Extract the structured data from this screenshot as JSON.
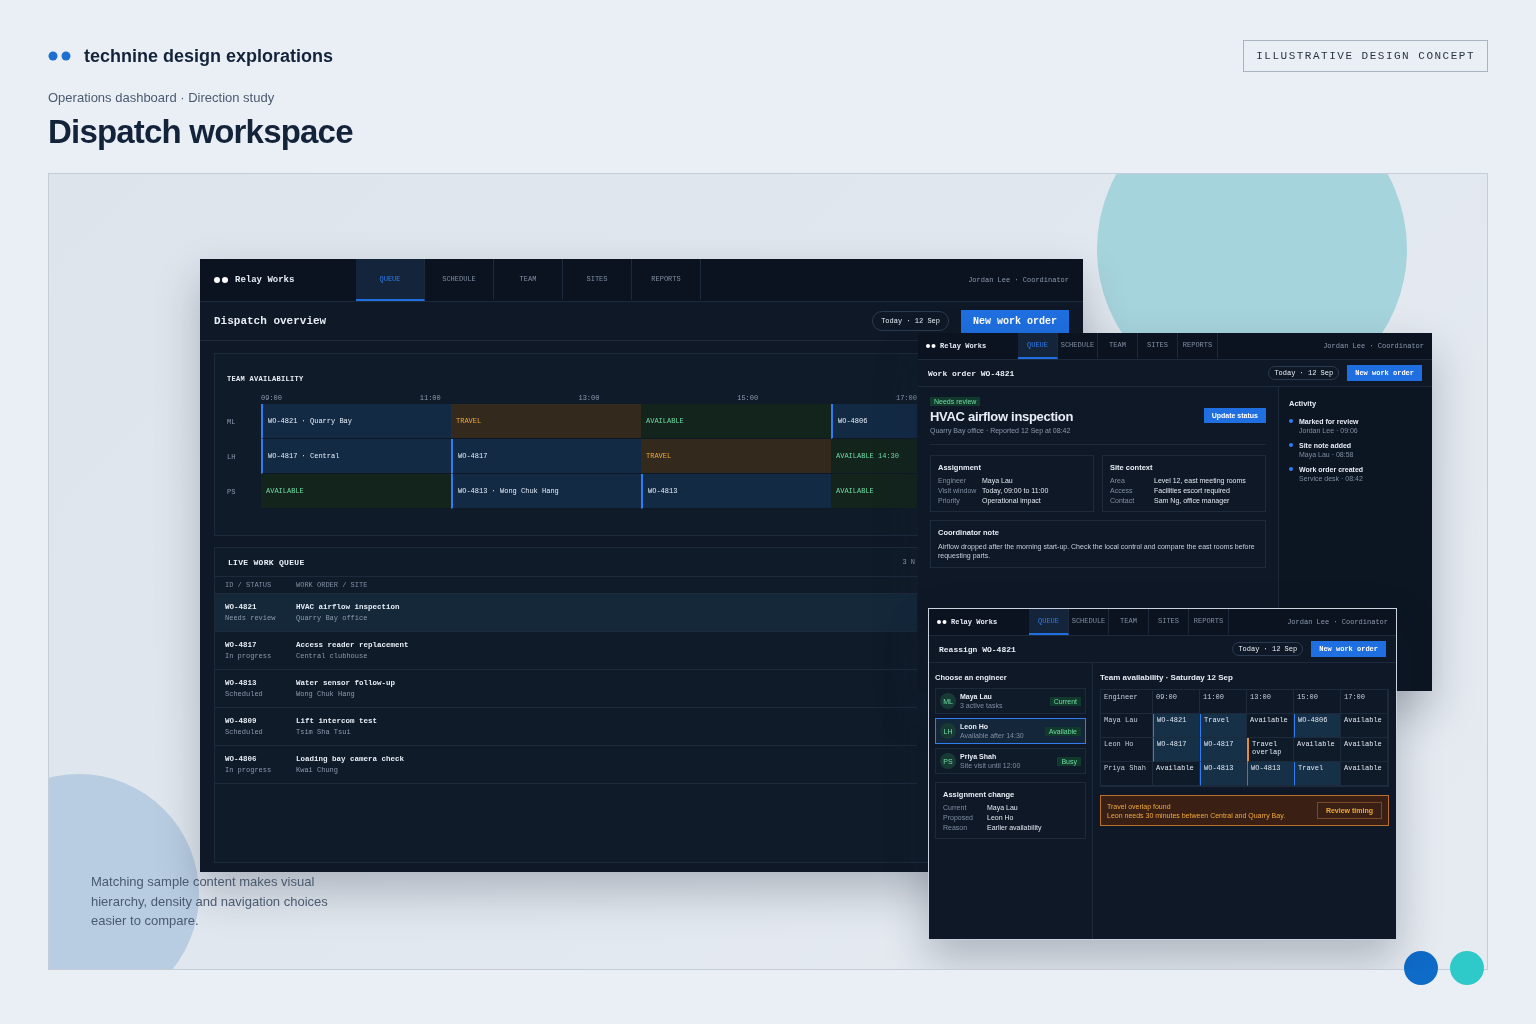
{
  "header": {
    "brand": "technine design explorations",
    "badge": "ILLUSTRATIVE DESIGN CONCEPT",
    "breadcrumb": "Operations dashboard · Direction study",
    "title": "Dispatch workspace"
  },
  "stage": {
    "caption": "Matching sample content makes visual hierarchy, density and navigation choices easier to compare."
  },
  "overview_screen": {
    "nav": {
      "brand": "Relay Works",
      "tabs": [
        {
          "label": "QUEUE",
          "selected": true
        },
        {
          "label": "SCHEDULE",
          "selected": false
        },
        {
          "label": "TEAM",
          "selected": false
        },
        {
          "label": "SITES",
          "selected": false
        },
        {
          "label": "REPORTS",
          "selected": false
        }
      ],
      "user": "Jordan Lee · Coordinator"
    },
    "title": "Dispatch overview",
    "date": "Today · 12 Sep",
    "action": "New work order",
    "availability": {
      "title": "TEAM AVAILABILITY",
      "times": [
        "09:00",
        "11:00",
        "13:00",
        "15:00",
        "17:00"
      ],
      "rows": [
        {
          "initials": "ML",
          "blocks": [
            {
              "label": "WO-4821 · Quarry Bay",
              "kind": "job"
            },
            {
              "label": "TRAVEL",
              "kind": "travel"
            },
            {
              "label": "AVAILABLE",
              "kind": "available"
            },
            {
              "label": "WO-4806",
              "kind": "job"
            }
          ]
        },
        {
          "initials": "LH",
          "blocks": [
            {
              "label": "WO-4817 · Central",
              "kind": "job"
            },
            {
              "label": "WO-4817",
              "kind": "job"
            },
            {
              "label": "TRAVEL",
              "kind": "travel"
            },
            {
              "label": "AVAILABLE 14:30",
              "kind": "available"
            }
          ]
        },
        {
          "initials": "PS",
          "blocks": [
            {
              "label": "AVAILABLE",
              "kind": "available"
            },
            {
              "label": "WO-4813 · Wong Chuk Hang",
              "kind": "job"
            },
            {
              "label": "WO-4813",
              "kind": "job"
            },
            {
              "label": "AVAILABLE",
              "kind": "available"
            }
          ]
        }
      ]
    },
    "queue": {
      "title": "LIVE WORK QUEUE",
      "count": "3 N",
      "columns": [
        "ID / STATUS",
        "WORK ORDER / SITE"
      ],
      "rows": [
        {
          "id": "WO-4821",
          "status": "Needs review",
          "title": "HVAC airflow inspection",
          "site": "Quarry Bay office",
          "selected": true
        },
        {
          "id": "WO-4817",
          "status": "In progress",
          "title": "Access reader replacement",
          "site": "Central clubhouse",
          "selected": false
        },
        {
          "id": "WO-4813",
          "status": "Scheduled",
          "title": "Water sensor follow-up",
          "site": "Wong Chuk Hang",
          "selected": false
        },
        {
          "id": "WO-4809",
          "status": "Scheduled",
          "title": "Lift intercom test",
          "site": "Tsim Sha Tsui",
          "selected": false
        },
        {
          "id": "WO-4806",
          "status": "In progress",
          "title": "Loading bay camera check",
          "site": "Kwai Chung",
          "selected": false
        }
      ]
    }
  },
  "work_order_screen": {
    "nav": {
      "brand": "Relay Works",
      "tabs": [
        {
          "label": "QUEUE",
          "selected": true
        },
        {
          "label": "SCHEDULE",
          "selected": false
        },
        {
          "label": "TEAM",
          "selected": false
        },
        {
          "label": "SITES",
          "selected": false
        },
        {
          "label": "REPORTS",
          "selected": false
        }
      ],
      "user": "Jordan Lee · Coordinator"
    },
    "title": "Work order WO-4821",
    "date": "Today · 12 Sep",
    "action": "New work order",
    "badge": "Needs review",
    "heading": "HVAC airflow inspection",
    "subtitle": "Quarry Bay office · Reported 12 Sep at 08:42",
    "update_button": "Update status",
    "assignment": {
      "title": "Assignment",
      "fields": [
        {
          "label": "Engineer",
          "value": "Maya Lau"
        },
        {
          "label": "Visit window",
          "value": "Today, 09:00 to 11:00"
        },
        {
          "label": "Priority",
          "value": "Operational impact"
        }
      ]
    },
    "site_context": {
      "title": "Site context",
      "fields": [
        {
          "label": "Area",
          "value": "Level 12, east meeting rooms"
        },
        {
          "label": "Access",
          "value": "Facilities escort required"
        },
        {
          "label": "Contact",
          "value": "Sam Ng, office manager"
        }
      ]
    },
    "note": {
      "title": "Coordinator note",
      "text": "Airflow dropped after the morning start-up. Check the local control and compare the east rooms before requesting parts."
    },
    "activity": {
      "title": "Activity",
      "items": [
        {
          "title": "Marked for review",
          "meta": "Jordan Lee · 09:06"
        },
        {
          "title": "Site note added",
          "meta": "Maya Lau · 08:58"
        },
        {
          "title": "Work order created",
          "meta": "Service desk · 08:42"
        }
      ]
    }
  },
  "reassign_screen": {
    "nav": {
      "brand": "Relay Works",
      "tabs": [
        {
          "label": "QUEUE",
          "selected": true
        },
        {
          "label": "SCHEDULE",
          "selected": false
        },
        {
          "label": "TEAM",
          "selected": false
        },
        {
          "label": "SITES",
          "selected": false
        },
        {
          "label": "REPORTS",
          "selected": false
        }
      ],
      "user": "Jordan Lee · Coordinator"
    },
    "title": "Reassign WO-4821",
    "date": "Today · 12 Sep",
    "action": "New work order",
    "engineers": {
      "title": "Choose an engineer",
      "items": [
        {
          "initials": "ML",
          "name": "Maya Lau",
          "detail": "3 active tasks",
          "badge": "Current",
          "selected": false
        },
        {
          "initials": "LH",
          "name": "Leon Ho",
          "detail": "Available after 14:30",
          "badge": "Available",
          "selected": true
        },
        {
          "initials": "PS",
          "name": "Priya Shah",
          "detail": "Site visit until 12:00",
          "badge": "Busy",
          "selected": false
        }
      ]
    },
    "change": {
      "title": "Assignment change",
      "fields": [
        {
          "label": "Current",
          "value": "Maya Lau"
        },
        {
          "label": "Proposed",
          "value": "Leon Ho"
        },
        {
          "label": "Reason",
          "value": "Earlier availability"
        }
      ]
    },
    "availability": {
      "title": "Team availability · Saturday 12 Sep",
      "columns": [
        "Engineer",
        "09:00",
        "11:00",
        "13:00",
        "15:00",
        "17:00"
      ],
      "rows": [
        {
          "cells": [
            {
              "label": "Maya Lau",
              "kind": "engineer"
            },
            {
              "label": "WO-4821",
              "kind": "job"
            },
            {
              "label": "Travel",
              "kind": "travel"
            },
            {
              "label": "Available",
              "kind": "available"
            },
            {
              "label": "WO-4806",
              "kind": "job"
            },
            {
              "label": "Available",
              "kind": "available"
            }
          ]
        },
        {
          "cells": [
            {
              "label": "Leon Ho",
              "kind": "engineer"
            },
            {
              "label": "WO-4817",
              "kind": "job"
            },
            {
              "label": "WO-4817",
              "kind": "job"
            },
            {
              "label": "Travel overlap",
              "kind": "conflict"
            },
            {
              "label": "Available",
              "kind": "available"
            },
            {
              "label": "Available",
              "kind": "available"
            }
          ]
        },
        {
          "cells": [
            {
              "label": "Priya Shah",
              "kind": "engineer"
            },
            {
              "label": "Available",
              "kind": "available"
            },
            {
              "label": "WO-4813",
              "kind": "job"
            },
            {
              "label": "WO-4813",
              "kind": "job"
            },
            {
              "label": "Travel",
              "kind": "travel"
            },
            {
              "label": "Available",
              "kind": "available"
            }
          ]
        }
      ]
    },
    "alert": {
      "title": "Travel overlap found",
      "text": "Leon needs 30 minutes between Central and Quarry Bay.",
      "button": "Review timing"
    }
  }
}
